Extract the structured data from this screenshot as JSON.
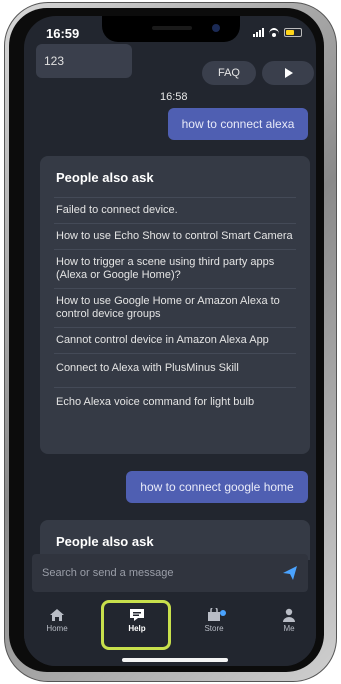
{
  "status_bar": {
    "time": "16:59"
  },
  "chat": {
    "previous_message": "123",
    "faq_label": "FAQ",
    "timestamp": "16:58",
    "user_message_1": "how to connect alexa",
    "user_message_2": "how to connect google home"
  },
  "suggestions_card": {
    "title": "People also ask",
    "items": [
      "Failed to connect device.",
      "How to use Echo Show to control Smart Camera",
      "How to trigger a scene using third party apps (Alexa or Google Home)?",
      "How to use Google Home or Amazon Alexa to control device groups",
      "Cannot control device in Amazon Alexa App",
      "Connect to Alexa with PlusMinus Skill",
      "Echo Alexa voice command for light bulb"
    ]
  },
  "suggestions_card_2": {
    "title": "People also ask"
  },
  "input": {
    "placeholder": "Search or send a message"
  },
  "bottom_nav": {
    "items": [
      {
        "label": "Home",
        "icon": "home-icon"
      },
      {
        "label": "Help",
        "icon": "help-chat-icon",
        "active": true
      },
      {
        "label": "Store",
        "icon": "store-bag-icon"
      },
      {
        "label": "Me",
        "icon": "person-icon"
      }
    ]
  },
  "colors": {
    "background": "#22262f",
    "user_bubble": "#4f5fb2",
    "card": "#353a45",
    "help_highlight": "#c8e04c",
    "send_icon": "#4aa3ff"
  }
}
